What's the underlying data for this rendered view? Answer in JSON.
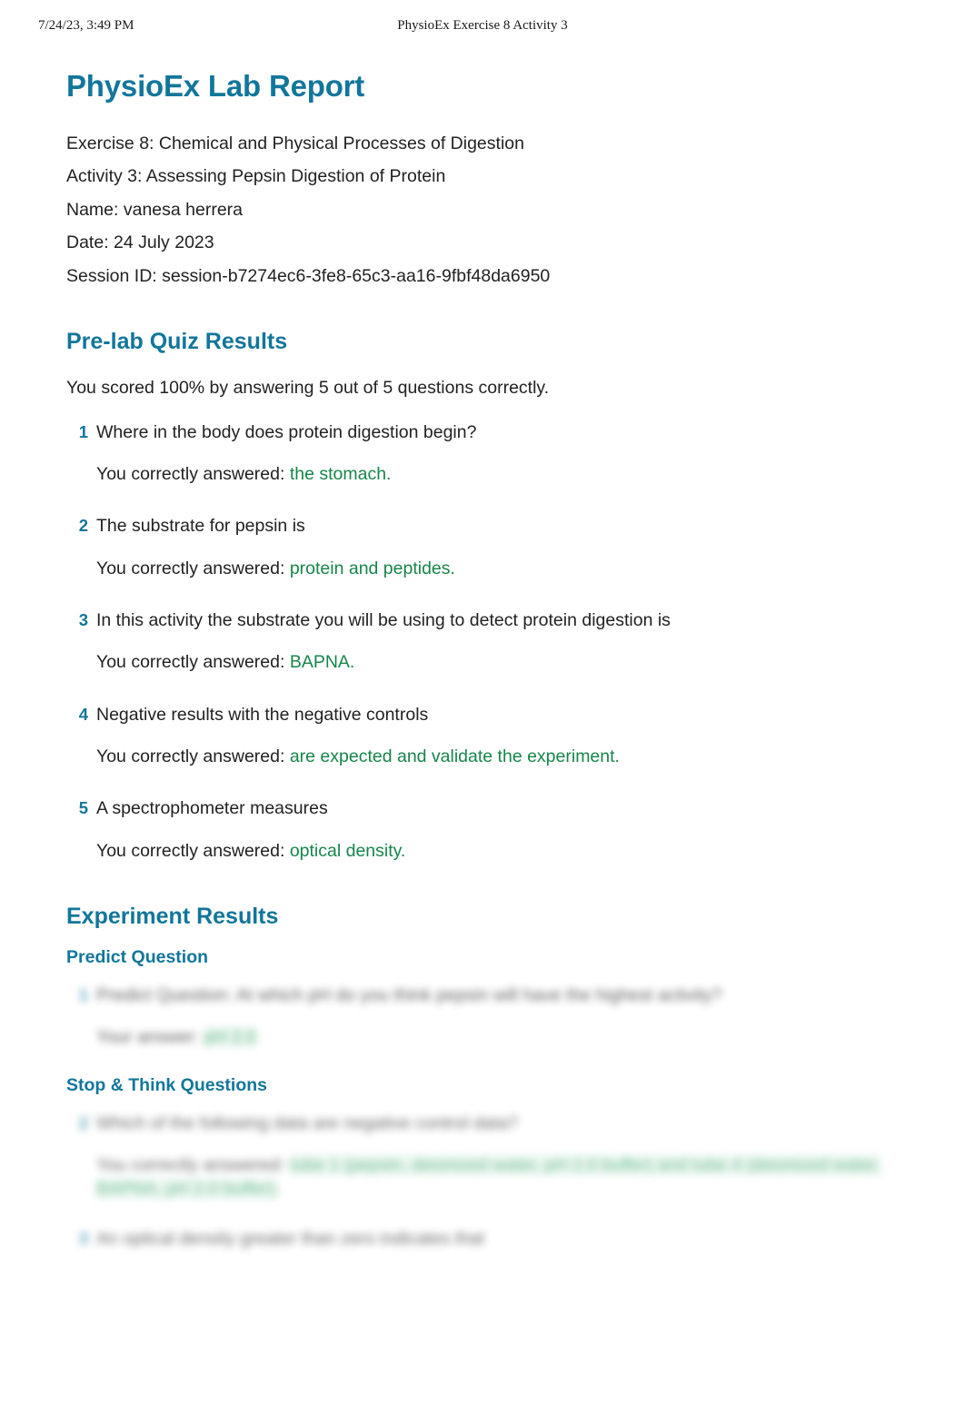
{
  "print_header": {
    "left": "7/24/23, 3:49 PM",
    "center": "PhysioEx Exercise 8 Activity 3"
  },
  "report": {
    "title": "PhysioEx Lab Report",
    "meta": {
      "exercise": "Exercise 8: Chemical and Physical Processes of Digestion",
      "activity": "Activity 3: Assessing Pepsin Digestion of Protein",
      "name": "Name: vanesa herrera",
      "date": "Date: 24 July 2023",
      "session_id": "Session ID: session-b7274ec6-3fe8-65c3-aa16-9fbf48da6950"
    }
  },
  "prelab": {
    "heading": "Pre-lab Quiz Results",
    "score_text": "You scored 100% by answering 5 out of 5 questions correctly.",
    "answer_prefix": "You correctly answered: ",
    "questions": [
      {
        "num": "1",
        "question": "Where in the body does protein digestion begin?",
        "answer": "the stomach."
      },
      {
        "num": "2",
        "question": "The substrate for pepsin is",
        "answer": "protein and peptides."
      },
      {
        "num": "3",
        "question": "In this activity the substrate you will be using to detect protein digestion is",
        "answer": "BAPNA."
      },
      {
        "num": "4",
        "question": "Negative results with the negative controls",
        "answer": "are expected and validate the experiment."
      },
      {
        "num": "5",
        "question": "A spectrophometer measures",
        "answer": "optical density."
      }
    ]
  },
  "experiment": {
    "heading": "Experiment Results",
    "predict": {
      "heading": "Predict Question",
      "num": "1",
      "question": "Predict Question: At which pH do you think pepsin will have the highest activity?",
      "answer_prefix": "Your answer:",
      "answer": "pH 2.0"
    },
    "stop_think": {
      "heading": "Stop & Think Questions",
      "answer_prefix": "You correctly answered:",
      "questions": [
        {
          "num": "2",
          "question": "Which of the following data are negative control data?",
          "answer": "tube 1 (pepsin, deionized water, pH 2.0 buffer) and tube 4 (deionized water, BAPNA, pH 2.0 buffer)."
        },
        {
          "num": "3",
          "question": "An optical density greater than zero indicates that",
          "answer": ""
        }
      ]
    }
  }
}
